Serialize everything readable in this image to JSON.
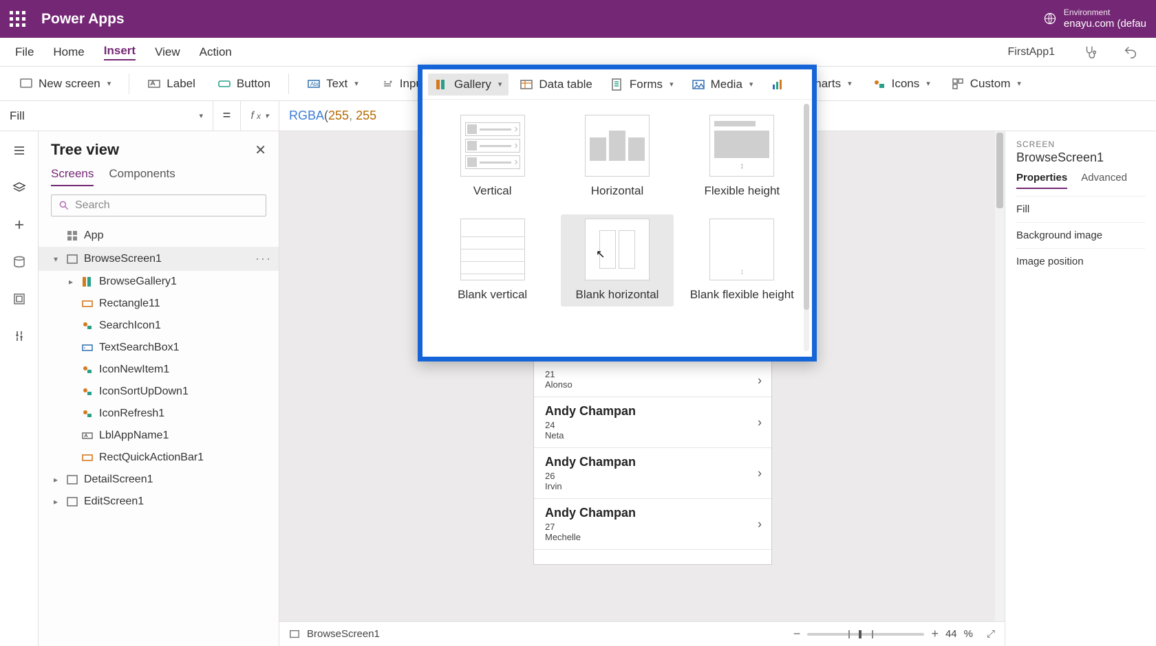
{
  "topbar": {
    "title": "Power Apps",
    "env_label": "Environment",
    "env_name": "enayu.com (defau"
  },
  "menubar": {
    "items": [
      "File",
      "Home",
      "Insert",
      "View",
      "Action"
    ],
    "active": "Insert",
    "app_name": "FirstApp1"
  },
  "ribbon": {
    "new_screen": "New screen",
    "label": "Label",
    "button": "Button",
    "text": "Text",
    "input": "Input",
    "gallery": "Gallery",
    "data_table": "Data table",
    "forms": "Forms",
    "media": "Media",
    "charts": "Charts",
    "icons": "Icons",
    "custom": "Custom"
  },
  "formula": {
    "property": "Fill",
    "fn": "RGBA",
    "args_display": "255, 255"
  },
  "tree": {
    "title": "Tree view",
    "tabs": {
      "screens": "Screens",
      "components": "Components"
    },
    "search_placeholder": "Search",
    "nodes": {
      "app": "App",
      "browse_screen": "BrowseScreen1",
      "browse_gallery": "BrowseGallery1",
      "rectangle": "Rectangle11",
      "search_icon": "SearchIcon1",
      "text_search": "TextSearchBox1",
      "icon_new": "IconNewItem1",
      "icon_sort": "IconSortUpDown1",
      "icon_refresh": "IconRefresh1",
      "lbl_app": "LblAppName1",
      "rect_quick": "RectQuickActionBar1",
      "detail_screen": "DetailScreen1",
      "edit_screen": "EditScreen1"
    }
  },
  "gallery_popup": {
    "items": [
      {
        "label": "Vertical"
      },
      {
        "label": "Horizontal"
      },
      {
        "label": "Flexible height"
      },
      {
        "label": "Blank vertical"
      },
      {
        "label": "Blank horizontal"
      },
      {
        "label": "Blank flexible height"
      }
    ]
  },
  "canvas_list": [
    {
      "name": "",
      "l2": "21",
      "l3": "Alonso"
    },
    {
      "name": "Andy Champan",
      "l2": "24",
      "l3": "Neta"
    },
    {
      "name": "Andy Champan",
      "l2": "26",
      "l3": "Irvin"
    },
    {
      "name": "Andy Champan",
      "l2": "27",
      "l3": "Mechelle"
    }
  ],
  "status": {
    "screen": "BrowseScreen1",
    "zoom": "44",
    "pct": "%"
  },
  "props": {
    "sub": "SCREEN",
    "title": "BrowseScreen1",
    "tabs": {
      "properties": "Properties",
      "advanced": "Advanced"
    },
    "rows": {
      "fill": "Fill",
      "bg": "Background image",
      "imgpos": "Image position"
    }
  }
}
